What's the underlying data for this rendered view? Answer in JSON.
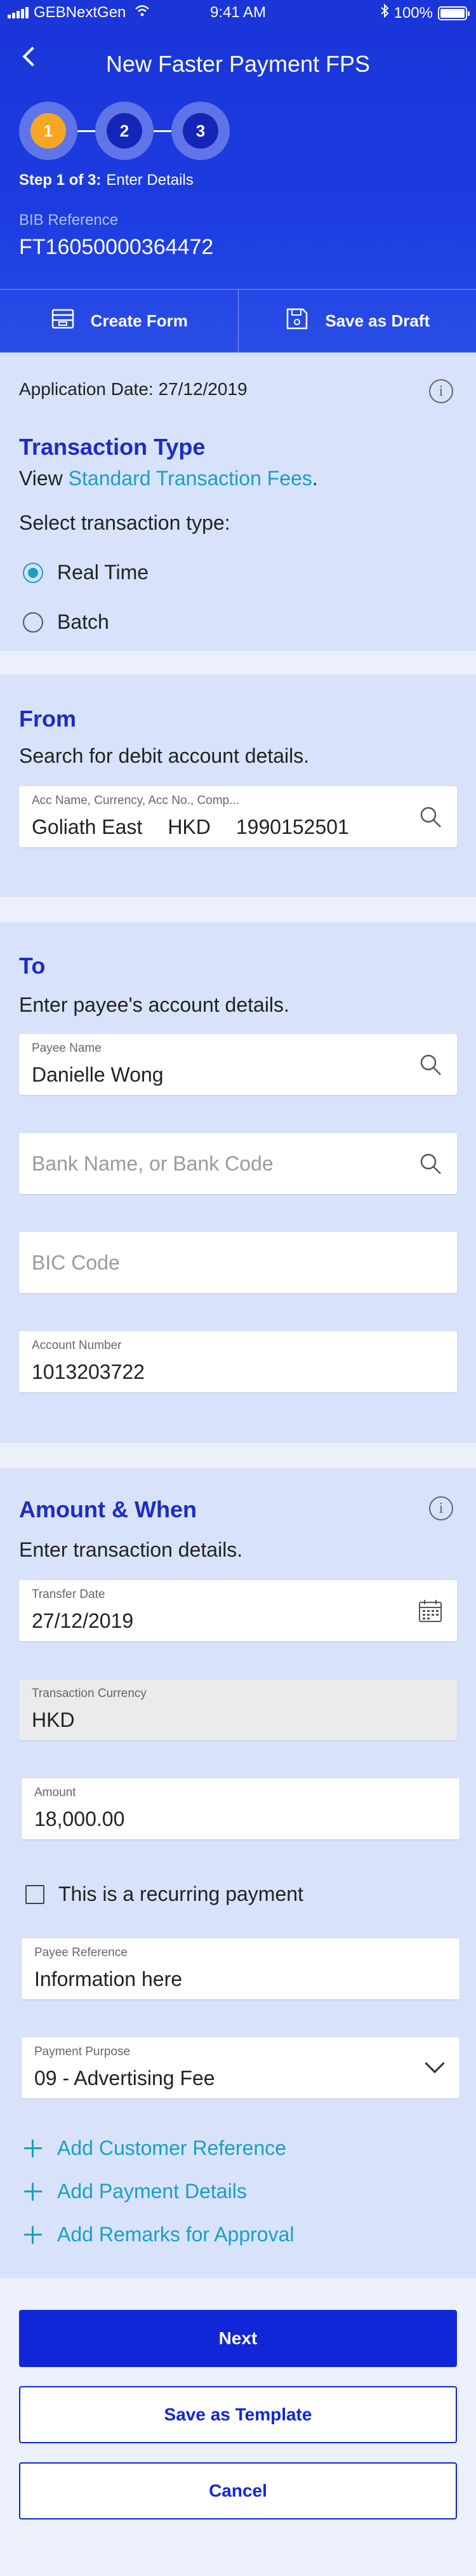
{
  "status_bar": {
    "carrier": "GEBNextGen",
    "time": "9:41 AM",
    "battery": "100%"
  },
  "header": {
    "title": "New Faster Payment FPS",
    "steps": [
      "1",
      "2",
      "3"
    ],
    "active_step": 1,
    "step_prefix": "Step 1 of 3:",
    "step_name": "Enter Details",
    "bib_label": "BIB Reference",
    "bib_value": "FT16050000364472",
    "create_form": "Create Form",
    "save_draft": "Save as Draft"
  },
  "transaction": {
    "app_date": "Application Date: 27/12/2019",
    "title": "Transaction Type",
    "view_prefix": "View ",
    "fees_link": "Standard Transaction Fees",
    "view_suffix": ".",
    "select_label": "Select transaction type:",
    "options": [
      "Real Time",
      "Batch"
    ],
    "selected": "Real Time"
  },
  "from": {
    "title": "From",
    "subtitle": "Search for debit account details.",
    "field_label": "Acc Name, Currency, Acc No., Comp...",
    "account_name": "Goliath East",
    "currency": "HKD",
    "account_number": "1990152501"
  },
  "to": {
    "title": "To",
    "subtitle": "Enter payee's account details.",
    "payee_label": "Payee Name",
    "payee_value": "Danielle Wong",
    "bank_placeholder": "Bank Name, or Bank Code",
    "bic_placeholder": "BIC Code",
    "account_label": "Account Number",
    "account_value": "1013203722"
  },
  "amount": {
    "title": "Amount & When",
    "subtitle": "Enter transaction details.",
    "transfer_date_label": "Transfer Date",
    "transfer_date_value": "27/12/2019",
    "currency_label": "Transaction Currency",
    "currency_value": "HKD",
    "amount_label": "Amount",
    "amount_value": "18,000.00",
    "recurring_label": "This is a recurring payment",
    "payee_ref_label": "Payee Reference",
    "payee_ref_value": "Information here",
    "purpose_label": "Payment Purpose",
    "purpose_value": "09 - Advertising Fee",
    "add_links": [
      "Add Customer Reference",
      "Add Payment Details",
      "Add Remarks for Approval"
    ]
  },
  "actions": {
    "next": "Next",
    "save_template": "Save as Template",
    "cancel": "Cancel"
  },
  "colors": {
    "header_blue": "#1c3ce0",
    "title_blue": "#1b2cc5",
    "link_teal": "#1a9fc7",
    "active_step": "#f5a623",
    "primary_button": "#1126d6"
  }
}
